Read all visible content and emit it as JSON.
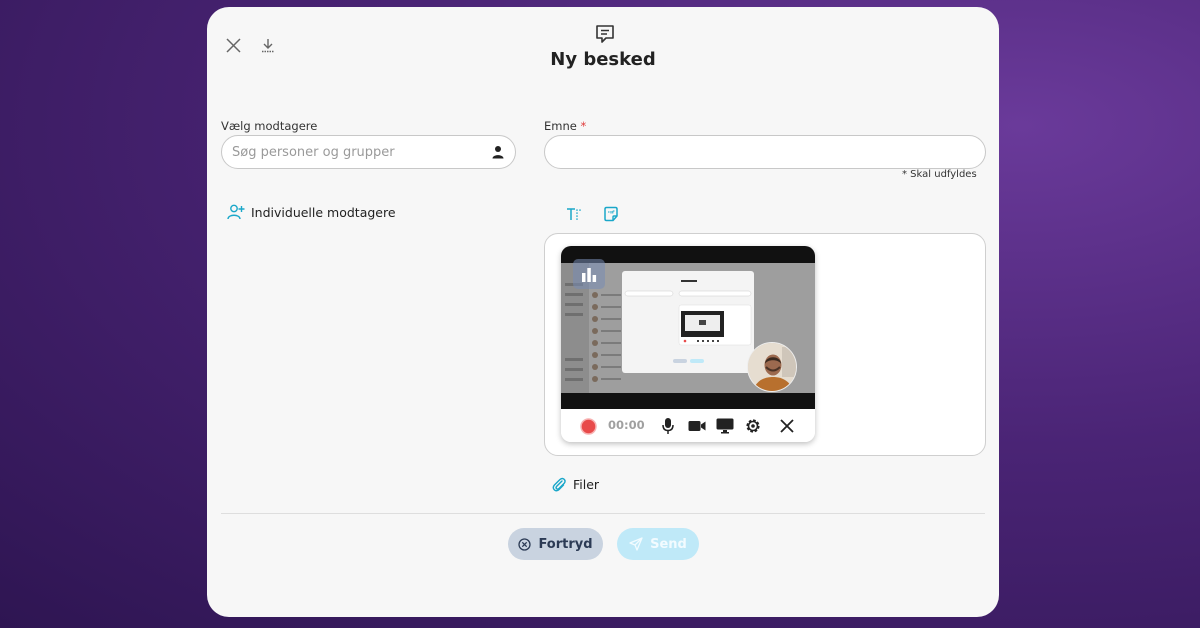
{
  "header": {
    "title": "Ny besked"
  },
  "recipients": {
    "label": "Vælg modtagere",
    "placeholder": "Søg personer og grupper",
    "individual_label": "Individuelle modtagere"
  },
  "subject": {
    "label": "Emne",
    "required_mark": "*",
    "value": "",
    "required_note": "* Skal udfyldes"
  },
  "recorder": {
    "timer": "00:00"
  },
  "attachments": {
    "label": "Filer"
  },
  "footer": {
    "cancel_label": "Fortryd",
    "send_label": "Send"
  },
  "colors": {
    "accent": "#1aa7c9",
    "record": "#e84a4a",
    "cancel_bg": "#c9d3e0",
    "send_bg": "#bfe9f8"
  }
}
